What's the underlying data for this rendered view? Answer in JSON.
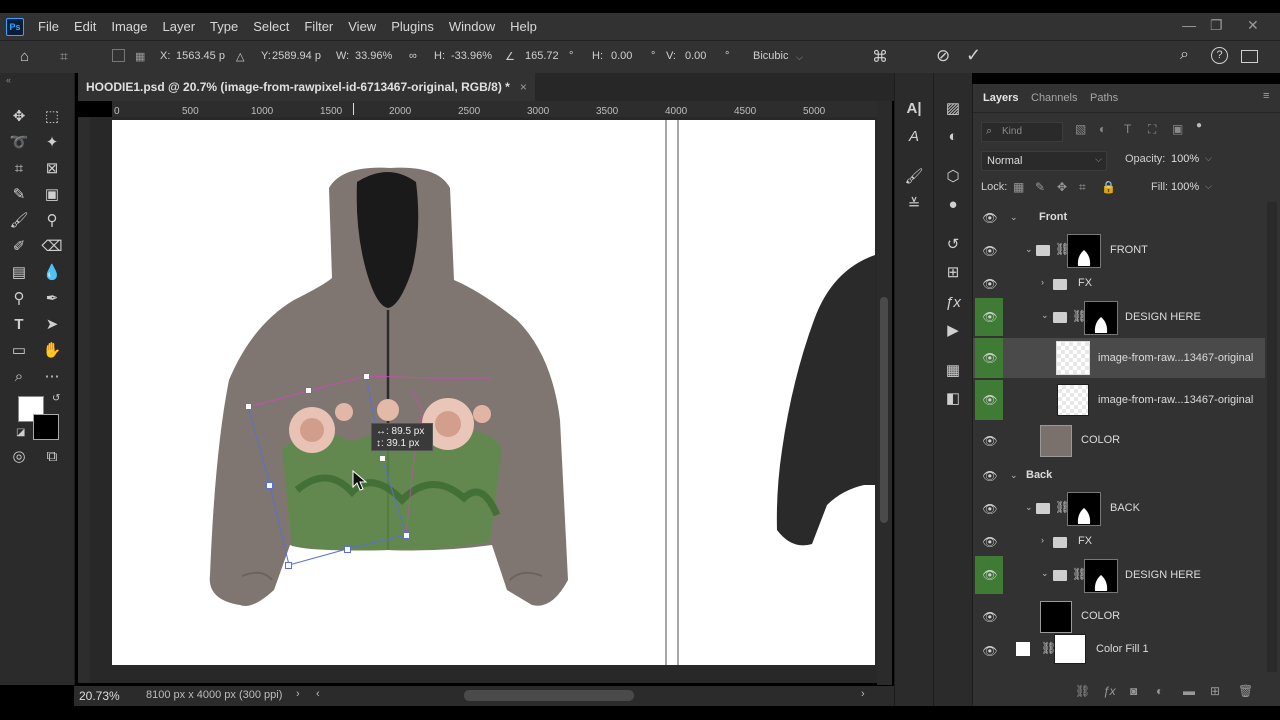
{
  "app": {
    "logo": "Ps",
    "menu": [
      "File",
      "Edit",
      "Image",
      "Layer",
      "Type",
      "Select",
      "Filter",
      "View",
      "Plugins",
      "Window",
      "Help"
    ]
  },
  "options": {
    "x_label": "X:",
    "x_value": "1563.45 p",
    "y_label": "Y:",
    "y_value": "2589.94 p",
    "w_label": "W:",
    "w_value": "33.96%",
    "h_label": "H:",
    "h_value": "-33.96%",
    "angle_value": "165.72",
    "angle_unit": "°",
    "hskew_label": "H:",
    "hskew_value": "0.00",
    "vskew_label": "V:",
    "vskew_value": "0.00",
    "interpolation": "Bicubic"
  },
  "document": {
    "tab_title": "HOODIE1.psd @ 20.7% (image-from-rawpixel-id-6713467-original, RGB/8) *",
    "close": "×",
    "zoom": "20.73%",
    "doc_info": "8100 px x 4000 px (300 ppi)"
  },
  "ruler": {
    "h_ticks": [
      "0",
      "500",
      "1000",
      "1500",
      "2000",
      "2500",
      "3000",
      "3500",
      "4000",
      "4500",
      "5000"
    ]
  },
  "transform_tooltip": {
    "dx": "↔: 89.5 px",
    "dy": "↕: 39.1 px"
  },
  "layers_panel": {
    "tabs": [
      "Layers",
      "Channels",
      "Paths"
    ],
    "filter_placeholder": "Kind",
    "blend_mode": "Normal",
    "opacity_label": "Opacity:",
    "opacity": "100%",
    "lock_label": "Lock:",
    "fill_label": "Fill:",
    "fill": "100%",
    "layers": [
      {
        "name": "Front",
        "type": "group"
      },
      {
        "name": "FRONT",
        "type": "group-mask"
      },
      {
        "name": "FX",
        "type": "folder"
      },
      {
        "name": "DESIGN HERE",
        "type": "group-mask"
      },
      {
        "name": "image-from-raw...13467-original",
        "type": "smart",
        "selected": true
      },
      {
        "name": "image-from-raw...13467-original",
        "type": "smart"
      },
      {
        "name": "COLOR",
        "type": "color"
      },
      {
        "name": "Back",
        "type": "group"
      },
      {
        "name": "BACK",
        "type": "group-mask"
      },
      {
        "name": "FX",
        "type": "folder"
      },
      {
        "name": "DESIGN HERE",
        "type": "group-mask"
      },
      {
        "name": "COLOR",
        "type": "color"
      },
      {
        "name": "Color Fill 1",
        "type": "fill"
      }
    ]
  },
  "colors": {
    "accent_blue": "#31a8ff",
    "eye_green": "#3f7b35",
    "hoodie": "#807671"
  }
}
